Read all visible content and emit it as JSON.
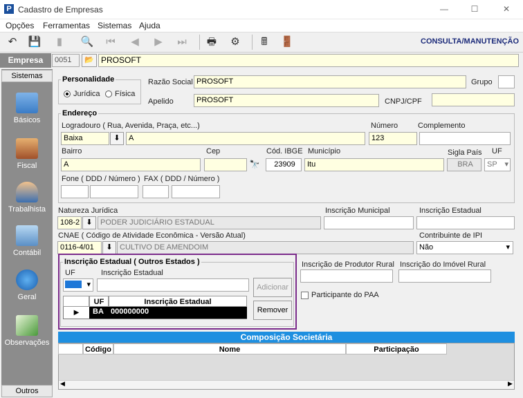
{
  "window": {
    "title": "Cadastro de Empresas",
    "minimize": "—",
    "maximize": "☐",
    "close": "✕"
  },
  "menu": [
    "Opções",
    "Ferramentas",
    "Sistemas",
    "Ajuda"
  ],
  "toolbar": {
    "mode_label": "CONSULTA/MANUTENÇÃO"
  },
  "empresa": {
    "label": "Empresa",
    "code": "0051",
    "name": "PROSOFT"
  },
  "sidebar": {
    "header": "Sistemas",
    "footer": "Outros",
    "items": [
      "Básicos",
      "Fiscal",
      "Trabalhista",
      "Contábil",
      "Geral",
      "Observações"
    ]
  },
  "personalidade": {
    "title": "Personalidade",
    "option1": "Jurídica",
    "option2": "Física",
    "selected": "Jurídica"
  },
  "razao_social": {
    "label": "Razão Social",
    "value": "PROSOFT"
  },
  "grupo": {
    "label": "Grupo",
    "value": ""
  },
  "apelido": {
    "label": "Apelido",
    "value": "PROSOFT"
  },
  "cnpj": {
    "label": "CNPJ/CPF",
    "value": ""
  },
  "endereco": {
    "title": "Endereço",
    "logradouro_label": "Logradouro ( Rua, Avenida, Praça, etc...)",
    "logradouro_tipo": "Baixa",
    "logradouro_value": "A",
    "numero_label": "Número",
    "numero_value": "123",
    "complemento_label": "Complemento",
    "complemento_value": "",
    "bairro_label": "Bairro",
    "bairro_value": "A",
    "cep_label": "Cep",
    "cep_value": "",
    "ibge_label": "Cód. IBGE",
    "ibge_value": "23909",
    "municipio_label": "Município",
    "municipio_value": "Itu",
    "sigla_pais_label": "Sigla País",
    "sigla_pais_value": "BRA",
    "uf_label": "UF",
    "uf_value": "SP",
    "fone_label": "Fone ( DDD / Número )",
    "fax_label": "FAX ( DDD / Número )"
  },
  "natureza": {
    "label": "Natureza Jurídica",
    "code": "108-2",
    "desc": "PODER JUDICIÁRIO ESTADUAL"
  },
  "insc_municipal": {
    "label": "Inscrição Municipal",
    "value": ""
  },
  "insc_estadual": {
    "label": "Inscrição Estadual",
    "value": ""
  },
  "cnae": {
    "label": "CNAE ( Código de Atividade Econômica - Versão Atual)",
    "code": "0116-4/01",
    "desc": "CULTIVO DE AMENDOIM"
  },
  "contribuinte_ipi": {
    "label": "Contribuinte de IPI",
    "value": "Não"
  },
  "outros_estados": {
    "title": "Inscrição Estadual ( Outros Estados )",
    "uf_label": "UF",
    "ie_label": "Inscrição Estadual",
    "add_button": "Adicionar",
    "remove_button": "Remover",
    "grid_headers": [
      "UF",
      "Inscrição Estadual"
    ],
    "rows": [
      {
        "uf": "BA",
        "ie": "000000000"
      }
    ]
  },
  "produtor_rural": {
    "label": "Inscrição de Produtor Rural",
    "value": ""
  },
  "imovel_rural": {
    "label": "Inscrição do Imóvel Rural",
    "value": ""
  },
  "paa": {
    "label": "Participante do PAA",
    "checked": false
  },
  "composicao": {
    "title": "Composição Societária",
    "headers": [
      "Código",
      "Nome",
      "Participação"
    ]
  }
}
